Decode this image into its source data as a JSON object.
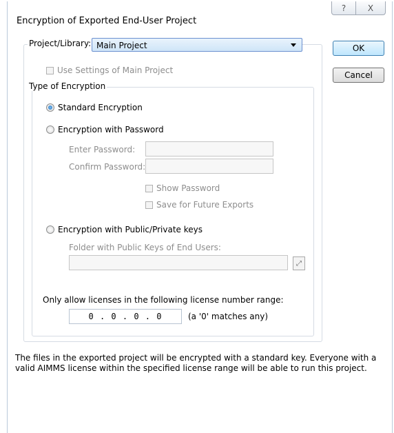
{
  "window": {
    "title": "Encryption of Exported End-User Project",
    "help_glyph": "?",
    "close_glyph": "X"
  },
  "project": {
    "label": "Project/Library:",
    "selected": "Main Project",
    "use_main_settings": "Use Settings of Main Project"
  },
  "buttons": {
    "ok": "OK",
    "cancel": "Cancel"
  },
  "encryption": {
    "group_title": "Type of Encryption",
    "standard": "Standard Encryption",
    "password": "Encryption with Password",
    "enter_password": "Enter Password:",
    "confirm_password": "Confirm Password:",
    "show_password": "Show Password",
    "save_future": "Save for Future Exports",
    "public_private": "Encryption with Public/Private keys",
    "folder_label": "Folder with Public Keys of End Users:",
    "browse_glyph": "⤢"
  },
  "license": {
    "label": "Only allow licenses in the following license number range:",
    "value": "0 . 0 . 0 . 0",
    "hint": "(a '0' matches any)"
  },
  "info_text": "The files in the exported project will be encrypted with a standard key. Everyone with a valid AIMMS license within the specified license range will be able to run this project."
}
